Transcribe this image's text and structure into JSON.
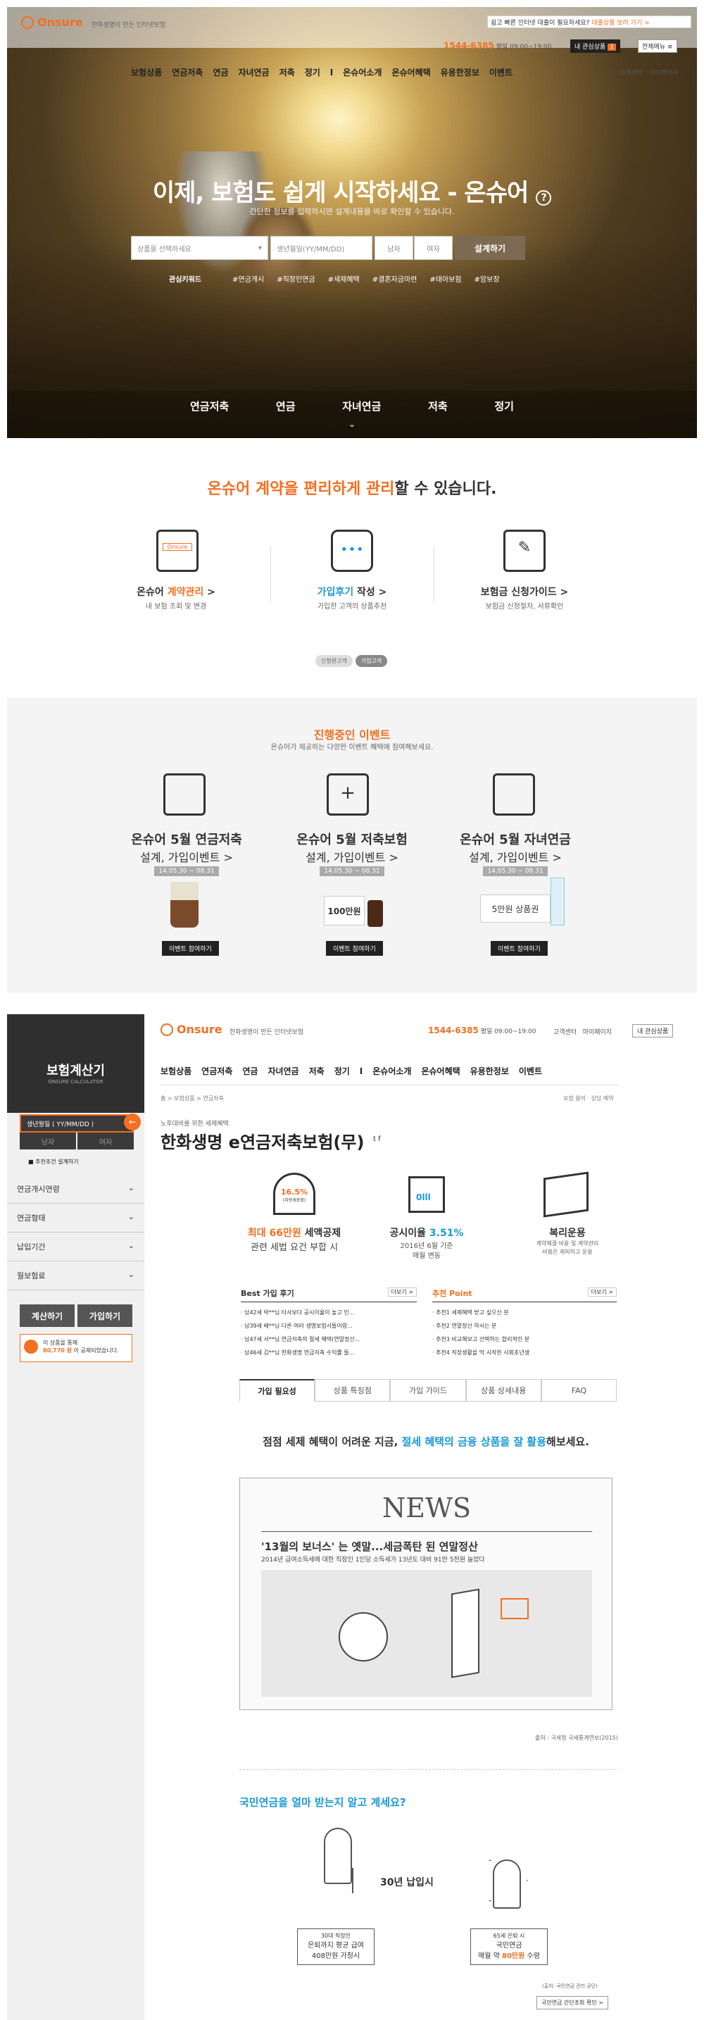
{
  "hero": {
    "logo": "Onsure",
    "tagline": "한화생명이 만든 인터넷보험",
    "promo": "쉽고 빠른 인터넷 대출이 필요하세요?",
    "promo_link": "대출상품 보러 가기 >",
    "phone": "1544-6385",
    "hours": "평일 09:00~19:00",
    "myinterest": "내 관심상품",
    "badge": "1",
    "allmenu": "전체메뉴 ≡",
    "nav": [
      "보험상품",
      "연금저축",
      "연금",
      "자녀연금",
      "저축",
      "정기",
      "I",
      "온슈어소개",
      "온슈어혜택",
      "유용한정보",
      "이벤트"
    ],
    "nav_util": [
      "고객센터",
      "마이페이지"
    ],
    "title": "이제, 보험도 쉽게 시작하세요 - 온슈어",
    "title_help": "?",
    "subtitle": "간단한 정보를 입력하시면 설계내용을 바로 확인할 수 있습니다.",
    "select_placeholder": "상품을 선택하세요",
    "birth_placeholder": "생년월일(YY/MM/DD)",
    "male": "남자",
    "female": "여자",
    "design_btn": "설계하기",
    "keywords_label": "관심키워드",
    "keywords": [
      "#연금개시",
      "#직장인연금",
      "#세제혜택",
      "#결혼자금마련",
      "#태아보험",
      "#암보장"
    ],
    "tabs": [
      "연금저축",
      "연금",
      "자녀연금",
      "저축",
      "정기"
    ]
  },
  "manage": {
    "title_orange": "온슈어 계약을 편리하게 관리",
    "title_rest": "할 수 있습니다.",
    "features": [
      {
        "title_a": "온슈어 ",
        "title_b": "계약관리",
        "arrow": " >",
        "sub": "내 보험 조회 및 변경"
      },
      {
        "title_a": "가입후기",
        "title_b": " 작성",
        "arrow": " >",
        "sub": "가입한 고객의 상품추천"
      },
      {
        "title_a": "보험금 신청가이드",
        "title_b": "",
        "arrow": " >",
        "sub": "보험금 신청절차, 서류확인"
      }
    ],
    "pills": [
      "신청완고객",
      "가입고객"
    ]
  },
  "events": {
    "title": "진행중인 이벤트",
    "sub": "온슈어가 제공하는 다양한 이벤트 혜택에 참여해보세요.",
    "items": [
      {
        "t1": "온슈어 5월 연금저축",
        "t2": "설계, 가입이벤트 >",
        "date": "14.05.30 ~ 08.31",
        "btn": "이벤트 참여하기"
      },
      {
        "t1": "온슈어 5월 저축보험",
        "t2": "설계, 가입이벤트 >",
        "date": "14.05.30 ~ 08.31",
        "btn": "이벤트 참여하기",
        "prize": "100만원"
      },
      {
        "t1": "온슈어 5월 자녀연금",
        "t2": "설계, 가입이벤트 >",
        "date": "14.05.30 ~ 08.31",
        "btn": "이벤트 참여하기",
        "prize": "5만원 상품권"
      }
    ]
  },
  "calc": {
    "title": "보험계산기",
    "sub": "ONSURE CALCULATOR",
    "birth": "생년월일 ( YY/MM/DD )",
    "male": "남자",
    "female": "여자",
    "check": "추천조건 설계하기",
    "menu": [
      "연금개시연령",
      "연금형태",
      "납입기간",
      "월보험료"
    ],
    "btn_calc": "계산하기",
    "btn_join": "가입하기",
    "note_a": "이 상품을 통해",
    "note_b": "80,770 원",
    "note_c": "이 공제되었습니다."
  },
  "page": {
    "logo": "Onsure",
    "tagline": "한화생명이 만든 인터넷보험",
    "phone": "1544-6385",
    "hours": "평일 09:00~19:00",
    "util": [
      "고객센터",
      "마이페이지"
    ],
    "myinterest": "내 관심상품",
    "nav": [
      "보험상품",
      "연금저축",
      "연금",
      "자녀연금",
      "저축",
      "정기",
      "I",
      "온슈어소개",
      "온슈어혜택",
      "유용한정보",
      "이벤트"
    ],
    "breadcrumb": "홈 > 보험상품 > 연금저축",
    "top_links": "보험 용어 · 상담 예약",
    "pre": "노후대비를 위한 세제혜택",
    "title": "한화생명 e연금저축보험(무)",
    "f1_badge": "16.5%",
    "f1_badge_sub": "(지방세포함)",
    "f1_a": "최대 ",
    "f1_b": "66만원",
    "f1_c": " 세액공제",
    "f1_d": "관련 세법 요건 부합 시",
    "f2_a": "공시이율 ",
    "f2_b": "3.51%",
    "f2_c": "2016년 6월 기준",
    "f2_d": "매월 변동",
    "f3_a": "복리운용",
    "f3_b": "계약체결 비용 및 계약관리",
    "f3_c": "비용은 제외하고 운용",
    "best_title": "Best 가입 후기",
    "best_more": "더보기 >",
    "best": [
      {
        "n": "남42세 박**님",
        "t": "타사보다 공시이율이 높고 인..."
      },
      {
        "n": "남39세 배**님",
        "t": "다른 여러 생명보험사들이랑..."
      },
      {
        "n": "남47세 서**님",
        "t": "연금저축의 절세 혜택(연말정산..."
      },
      {
        "n": "남46세 김**님",
        "t": "한화생명 연금저축 수익률 들..."
      }
    ],
    "rec_title": "추천 Point",
    "rec_more": "더보기 >",
    "rec": [
      {
        "n": "추천1",
        "t": "세제혜택 받고 싶으신 분"
      },
      {
        "n": "추천2",
        "t": "연말정산 하시는 분"
      },
      {
        "n": "추천3",
        "t": "비교해보고 선택하는 합리적인 분"
      },
      {
        "n": "추천4",
        "t": "직장생활을 막 시작한 사회초년생"
      }
    ],
    "tabs": [
      "가입 필요성",
      "상품 특징점",
      "가입 가이드",
      "상품 상세내용",
      "FAQ"
    ],
    "lead_a": "점점 세제 혜택이 어려운 지금, ",
    "lead_b": "절세 혜택의 금융 상품을 잘 활용",
    "lead_c": "해보세요.",
    "news_head": "NEWS",
    "news_title": "'13월의 보너스' 는 옛말...세금폭탄 된 연말정산",
    "news_sub": "2014년 급여소득세에 대한 직장인 1인당 소득세가 13년도 대비 91만 5천원 늘었다",
    "news_source": "출처 : 국세청 국세통계연보(2015)",
    "q": "국민연금을 얼마 받는지 알고 계세요?",
    "years": "30년 납입시",
    "box1": [
      "30대 직장인",
      "은퇴까지 평균 급여",
      "408만원 가정시"
    ],
    "box2": [
      "65세 은퇴 시",
      "국민연금",
      "매월 약 "
    ],
    "box2_amt": "80만원",
    "box2_end": " 수령",
    "box2_note": "(출처: 국민연금 관리 공단)",
    "pension_btn": "국민연금 간단조회 확인 >"
  }
}
